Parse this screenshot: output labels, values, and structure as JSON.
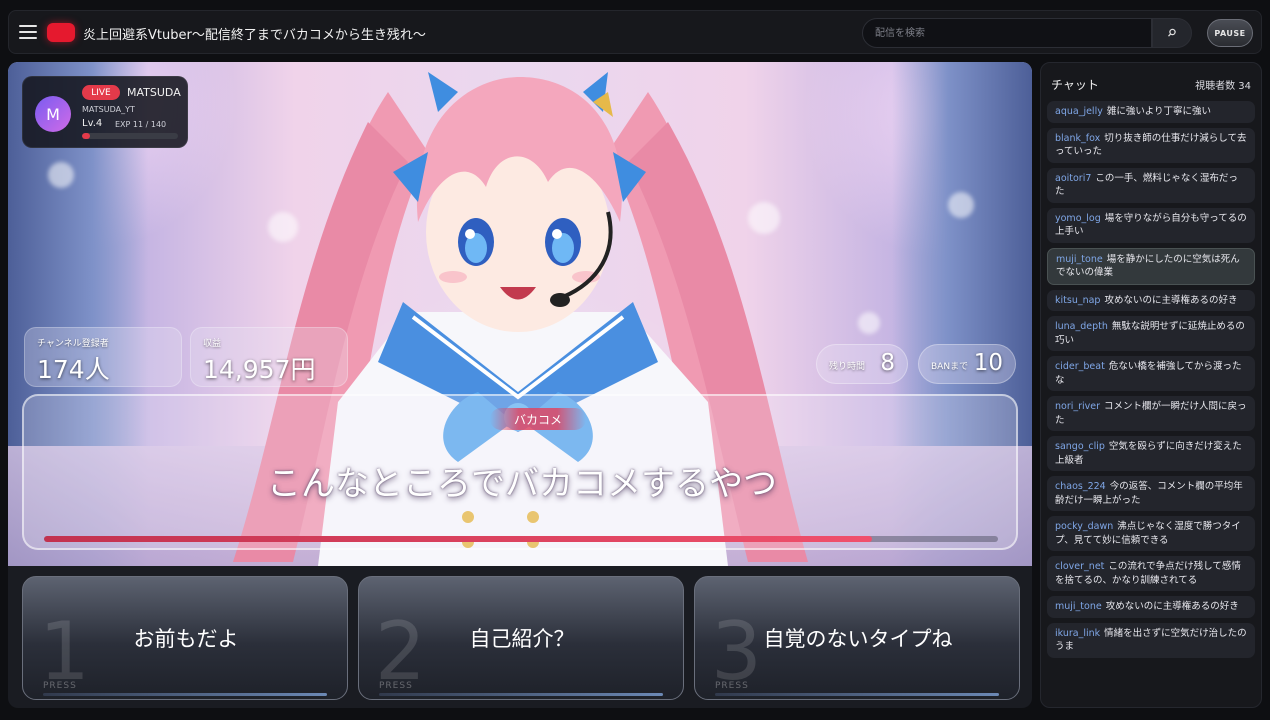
{
  "header": {
    "title": "炎上回避系Vtuber〜配信終了までバカコメから生き残れ〜",
    "search_placeholder": "配信を検索",
    "pause_label": "PAUSE",
    "brand_color": "#e5192e"
  },
  "profile": {
    "avatar_initial": "M",
    "live_label": "LIVE",
    "name": "MATSUDA",
    "handle": "MATSUDA_YT",
    "level": "Lv.4",
    "exp_text": "EXP  11 / 140",
    "exp_fraction": 0.0786
  },
  "stats": {
    "subscribers_label": "チャンネル登録者",
    "subscribers_value": "174人",
    "revenue_label": "収益",
    "revenue_value": "14,957円",
    "time_left_label": "残り時間",
    "time_left_value": "8",
    "ban_label": "BANまで",
    "ban_value": "10"
  },
  "comment": {
    "tag": "バカコメ",
    "text": "こんなところでバカコメするやつ",
    "timer_fraction": 0.868,
    "accent_color": "#e0445f"
  },
  "choices": [
    {
      "number": "1",
      "label": "お前もだよ",
      "press": "PRESS"
    },
    {
      "number": "2",
      "label": "自己紹介？",
      "press": "PRESS"
    },
    {
      "number": "3",
      "label": "自覚のないタイプね",
      "press": "PRESS"
    }
  ],
  "chat": {
    "title": "チャット",
    "viewers": "視聴者数  34",
    "messages": [
      {
        "user": "aqua_jelly",
        "text": "雑に強いより丁寧に強い"
      },
      {
        "user": "blank_fox",
        "text": "切り抜き師の仕事だけ減らして去っていった"
      },
      {
        "user": "aoitori7",
        "text": "この一手、燃料じゃなく湿布だった"
      },
      {
        "user": "yomo_log",
        "text": "場を守りながら自分も守ってるの上手い"
      },
      {
        "user": "muji_tone",
        "text": "場を静かにしたのに空気は死んでないの偉業"
      },
      {
        "user": "kitsu_nap",
        "text": "攻めないのに主導権あるの好き"
      },
      {
        "user": "luna_depth",
        "text": "無駄な説明せずに延焼止めるの巧い"
      },
      {
        "user": "cider_beat",
        "text": "危ない橋を補強してから渡ったな"
      },
      {
        "user": "nori_river",
        "text": "コメント欄が一瞬だけ人間に戻った"
      },
      {
        "user": "sango_clip",
        "text": "空気を殴らずに向きだけ変えた上級者"
      },
      {
        "user": "chaos_224",
        "text": "今の返答、コメント欄の平均年齢だけ一瞬上がった"
      },
      {
        "user": "pocky_dawn",
        "text": "沸点じゃなく湿度で勝つタイプ、見てて妙に信頼できる"
      },
      {
        "user": "clover_net",
        "text": "この流れで争点だけ残して感情を捨てるの、かなり訓練されてる"
      },
      {
        "user": "muji_tone",
        "text": "攻めないのに主導権あるの好き"
      },
      {
        "user": "ikura_link",
        "text": "情緒を出さずに空気だけ治したのうま"
      }
    ]
  }
}
